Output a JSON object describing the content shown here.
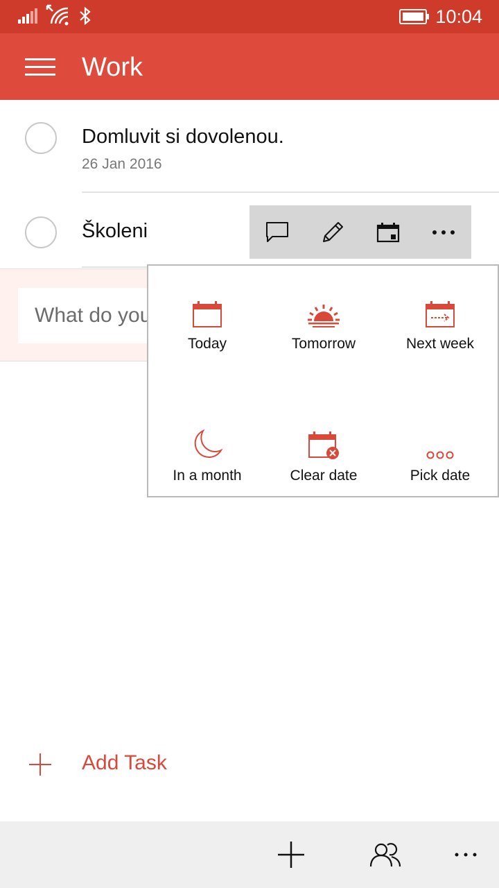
{
  "status": {
    "time": "10:04"
  },
  "header": {
    "title": "Work"
  },
  "tasks": [
    {
      "title": "Domluvit si dovolenou.",
      "date": "26 Jan 2016"
    },
    {
      "title": "Školeni",
      "date": ""
    }
  ],
  "new_task": {
    "placeholder": "What do you need to do?"
  },
  "date_options": [
    {
      "label": "Today",
      "icon": "calendar-icon"
    },
    {
      "label": "Tomorrow",
      "icon": "sunrise-icon"
    },
    {
      "label": "Next week",
      "icon": "calendar-arrow-icon"
    },
    {
      "label": "In a month",
      "icon": "moon-icon"
    },
    {
      "label": "Clear date",
      "icon": "calendar-clear-icon"
    },
    {
      "label": "Pick date",
      "icon": "ellipsis-circles-icon"
    }
  ],
  "add_task": {
    "label": "Add Task"
  },
  "colors": {
    "status_bar": "#cf3b2b",
    "header": "#de4b3d",
    "accent": "#d9493a",
    "toolbar": "#d6d6d6",
    "appbar": "#efefef"
  }
}
